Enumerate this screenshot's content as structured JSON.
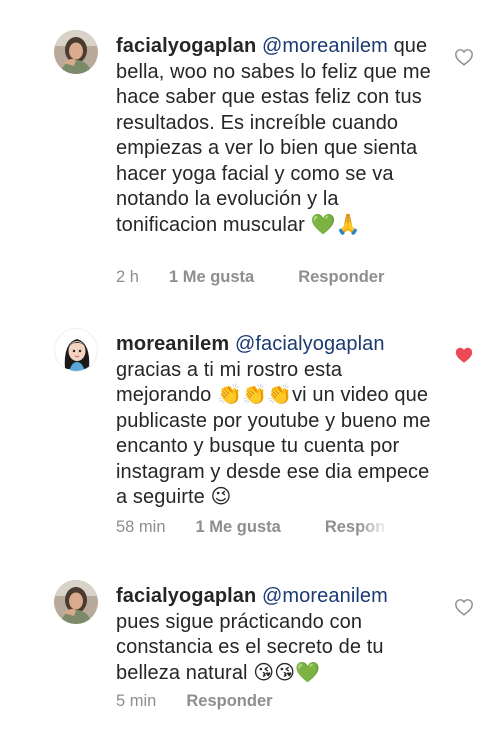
{
  "comments": [
    {
      "username": "facialyogaplan",
      "mention": "@moreanilem",
      "text": "que bella, woo no sabes lo feliz que me hace saber que estas feliz con tus resultados. Es increíble cuando empiezas a ver lo bien que sienta hacer yoga facial y como se va notando la evolución y la tonificacion muscular 💚🙏",
      "time": "2 h",
      "likes": "1 Me gusta",
      "reply": "Responder",
      "liked": false,
      "avatar_icon": "woman-profile-photo"
    },
    {
      "username": "moreanilem",
      "mention": "@facialyogaplan",
      "text": "gracias a ti mi rostro esta mejorando 👏👏👏vi un video que publicaste por youtube  y bueno me encanto y  busque tu cuenta por instagram y desde ese dia empece a seguirte 😉",
      "time": "58 min",
      "likes": "1 Me gusta",
      "reply": "Respon",
      "liked": true,
      "avatar_icon": "cartoon-girl-avatar"
    },
    {
      "username": "facialyogaplan",
      "mention": "@moreanilem",
      "text": "pues sigue prácticando con constancia es el secreto de tu belleza natural 😘😘💚",
      "time": "5 min",
      "likes": "",
      "reply": "Responder",
      "liked": false,
      "avatar_icon": "woman-profile-photo"
    }
  ],
  "colors": {
    "text": "#262626",
    "mention": "#1b3a72",
    "meta": "#8e8e8e",
    "heart_liked": "#ed4956",
    "heart_outline": "#8e8e8e"
  }
}
